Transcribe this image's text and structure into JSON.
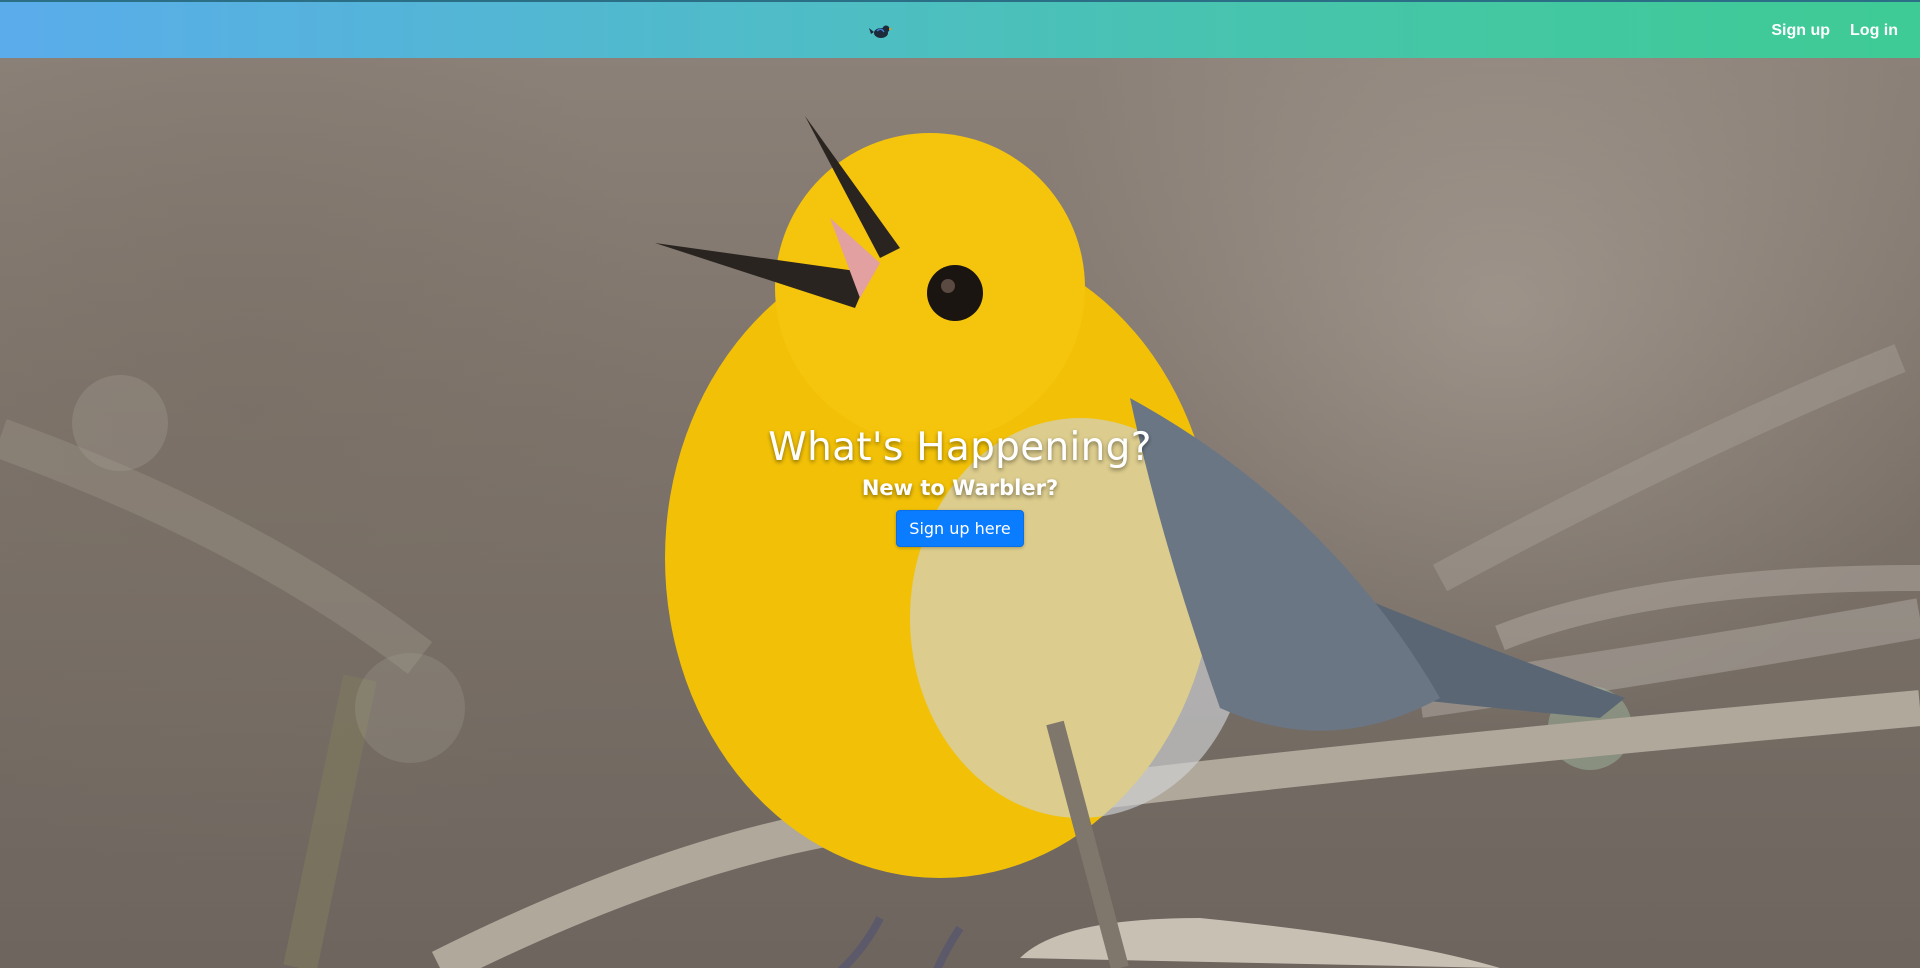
{
  "navbar": {
    "brand_icon": "bird-logo-icon",
    "signup_label": "Sign up",
    "login_label": "Log in",
    "gradient_start": "#5aaceb",
    "gradient_end": "#3ecb95"
  },
  "hero": {
    "background_image": "yellow-warbler-singing-photo",
    "title": "What's Happening?",
    "subtitle": "New to Warbler?",
    "cta_label": "Sign up here",
    "cta_color": "#0a7cff"
  }
}
